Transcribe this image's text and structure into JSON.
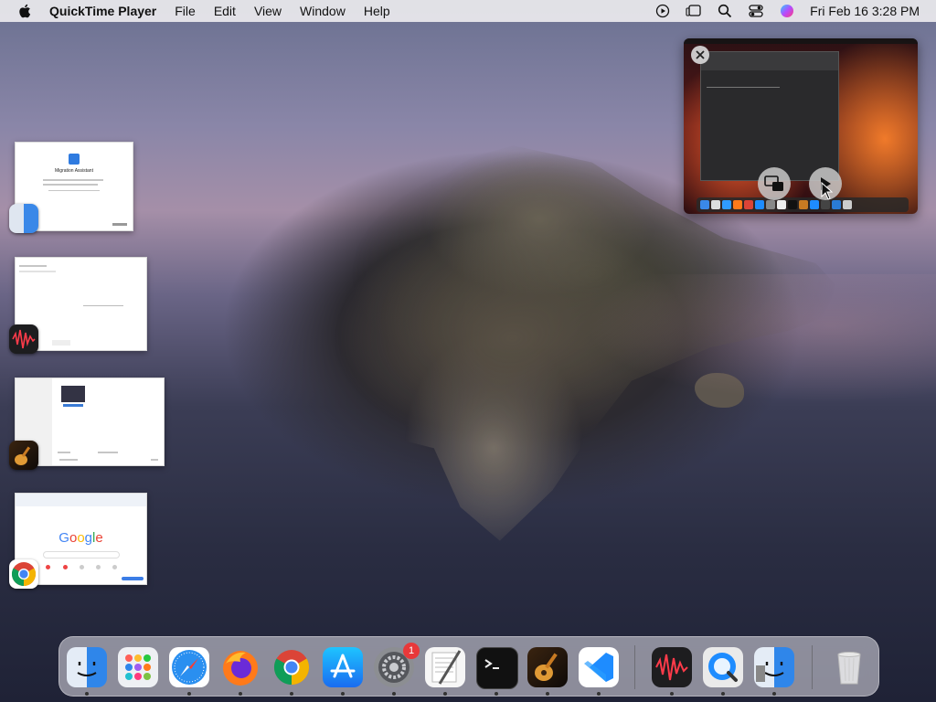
{
  "menubar": {
    "app_name": "QuickTime Player",
    "menus": [
      "File",
      "Edit",
      "View",
      "Window",
      "Help"
    ],
    "clock": "Fri Feb 16  3:28 PM"
  },
  "thumbnails": [
    {
      "app": "Finder",
      "title": "Migration Assistant"
    },
    {
      "app": "Voice Memos",
      "title": ""
    },
    {
      "app": "GarageBand",
      "title": ""
    },
    {
      "app": "Google Chrome",
      "title": "Google"
    }
  ],
  "pip": {
    "close_icon": "close-icon",
    "exit_pip_icon": "exit-pip-icon",
    "play_icon": "play-icon"
  },
  "dock": {
    "items": [
      "Finder",
      "Launchpad",
      "Safari",
      "Firefox",
      "Google Chrome",
      "App Store",
      "System Settings",
      "TextEdit",
      "Terminal",
      "GarageBand",
      "Visual Studio Code",
      "Voice Memos",
      "QuickTime Player",
      "Migration Assistant",
      "Trash"
    ],
    "system_settings_badge": "1"
  },
  "colors": {
    "menubar_bg": "#eceaee",
    "badge_red": "#e8383a"
  }
}
